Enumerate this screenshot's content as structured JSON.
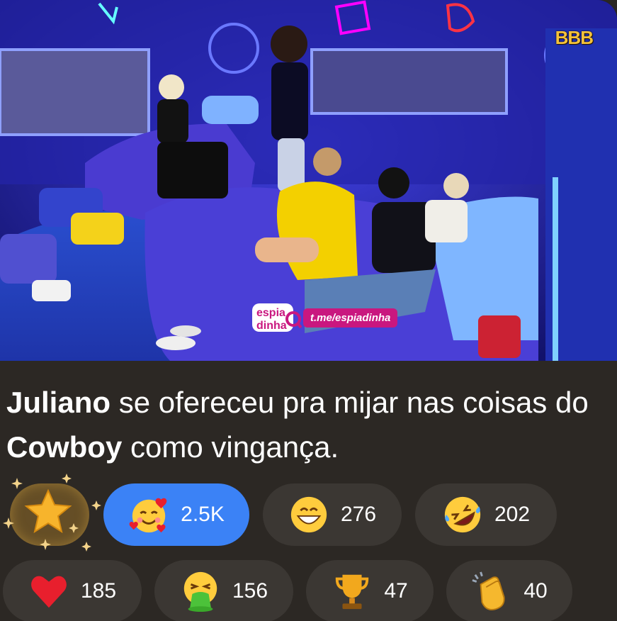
{
  "photo": {
    "logo_text": "BBB",
    "watermark_brand": "espia dinha",
    "watermark_link": "t.me/espiadinha"
  },
  "caption": {
    "name1": "Juliano",
    "text1": " se ofereceu pra mijar nas coisas do ",
    "name2": "Cowboy",
    "text2": " como vingança."
  },
  "reactions": [
    {
      "icon": "star-icon",
      "count": ""
    },
    {
      "icon": "smiling-face-with-hearts-icon",
      "count": "2.5K",
      "active": true
    },
    {
      "icon": "grinning-face-icon",
      "count": "276"
    },
    {
      "icon": "rolling-laughing-face-icon",
      "count": "202"
    },
    {
      "icon": "red-heart-icon",
      "count": "185"
    },
    {
      "icon": "vomiting-face-icon",
      "count": "156"
    },
    {
      "icon": "trophy-icon",
      "count": "47"
    },
    {
      "icon": "clapping-hands-icon",
      "count": "40"
    }
  ],
  "colors": {
    "background": "#2c2824",
    "chip": "#3b3733",
    "chip_active": "#3b82f6",
    "text": "#ffffff"
  }
}
